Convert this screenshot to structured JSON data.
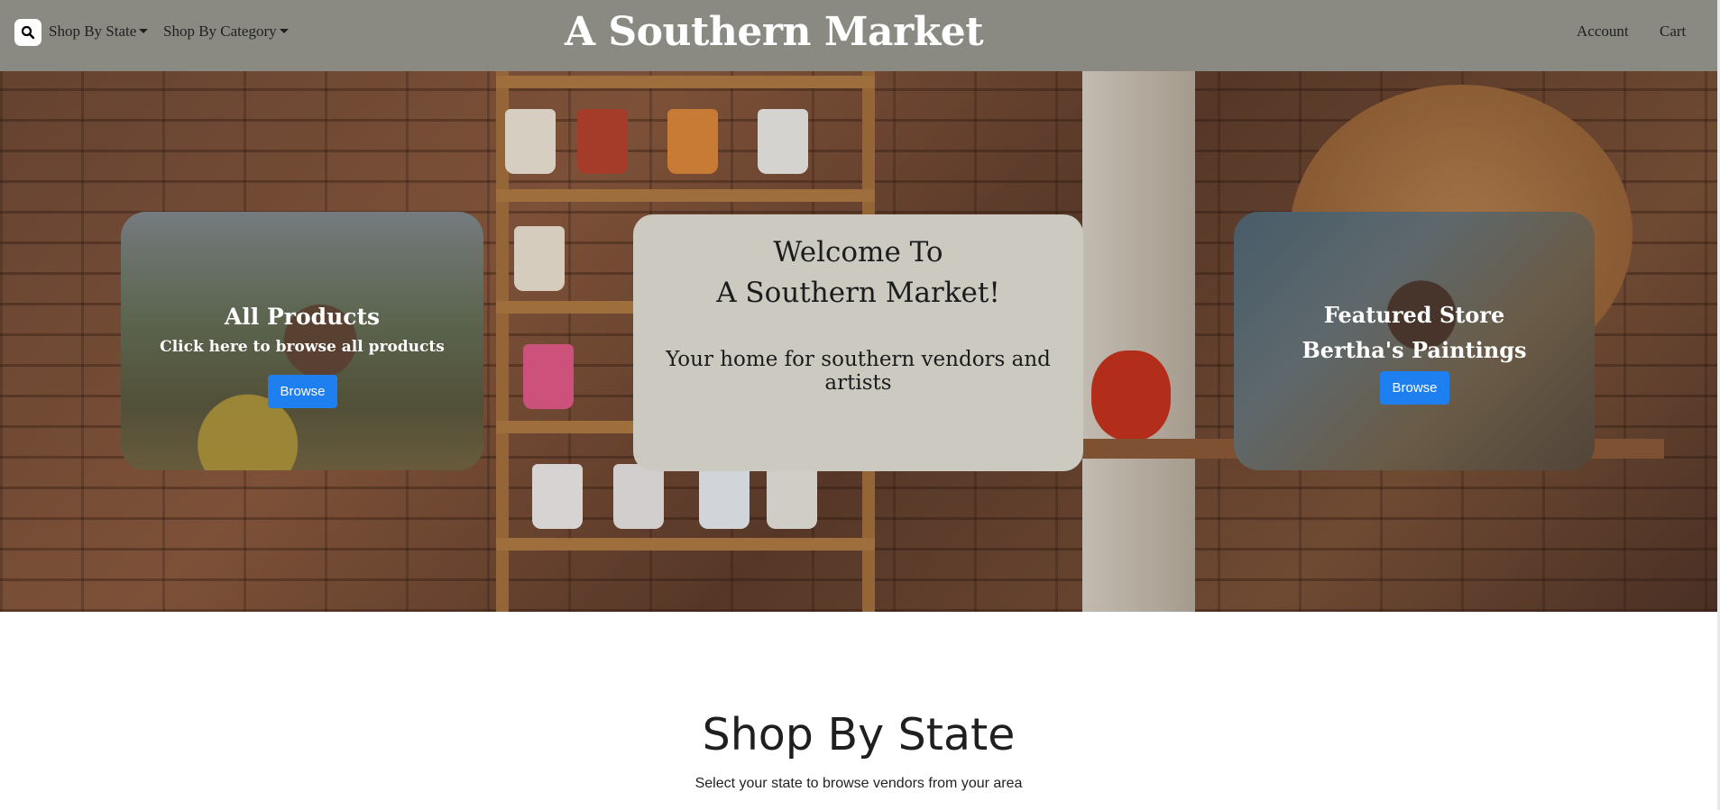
{
  "navbar": {
    "search_icon": "search-icon",
    "shop_by_state_label": "Shop By State",
    "shop_by_category_label": "Shop By Category",
    "brand": "A Southern Market",
    "account_label": "Account",
    "cart_label": "Cart",
    "background_color": "#8a8a82"
  },
  "hero": {
    "left_card": {
      "title": "All Products",
      "subtitle": "Click here to browse all products",
      "button_label": "Browse"
    },
    "center_card": {
      "title_line1": "Welcome To",
      "title_line2": "A Southern Market!",
      "subtitle": "Your home for southern vendors and artists"
    },
    "right_card": {
      "title_line1": "Featured Store",
      "title_line2": "Bertha's Paintings",
      "button_label": "Browse"
    },
    "button_color": "#1e7ff0"
  },
  "shop_by_state": {
    "title": "Shop By State",
    "subtitle": "Select your state to browse vendors from your area"
  }
}
